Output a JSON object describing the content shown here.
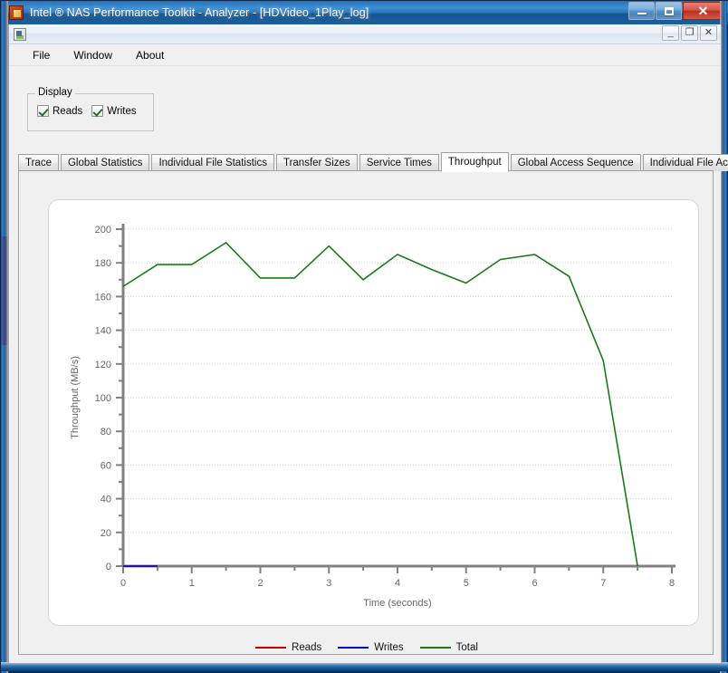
{
  "window": {
    "title": "Intel ® NAS Performance Toolkit - Analyzer - [HDVideo_1Play_log]",
    "app_icon": "app-icon",
    "buttons": {
      "minimize": "minimize-icon",
      "maximize": "maximize-icon",
      "close": "✕"
    }
  },
  "mdi": {
    "icon": "document-icon",
    "buttons": {
      "minimize": "_",
      "restore": "❐",
      "close": "✕"
    }
  },
  "menu": {
    "items": [
      {
        "label": "File"
      },
      {
        "label": "Window"
      },
      {
        "label": "About"
      }
    ]
  },
  "display_group": {
    "legend": "Display",
    "checkboxes": [
      {
        "label": "Reads",
        "checked": true
      },
      {
        "label": "Writes",
        "checked": true
      }
    ]
  },
  "tabs": {
    "active_index": 5,
    "items": [
      {
        "label": "Trace"
      },
      {
        "label": "Global Statistics"
      },
      {
        "label": "Individual File Statistics"
      },
      {
        "label": "Transfer Sizes"
      },
      {
        "label": "Service Times"
      },
      {
        "label": "Throughput"
      },
      {
        "label": "Global Access Sequence"
      },
      {
        "label": "Individual File Access Sequence"
      }
    ]
  },
  "chart_data": {
    "type": "line",
    "title": "",
    "xlabel": "Time (seconds)",
    "ylabel": "Throughput (MB/s)",
    "xlim": [
      0,
      8
    ],
    "ylim": [
      0,
      200
    ],
    "xticks": [
      0,
      1,
      2,
      3,
      4,
      5,
      6,
      7,
      8
    ],
    "xtick_labels": [
      "0",
      "1",
      "2",
      "3",
      "4",
      "5",
      "6",
      "7",
      "8"
    ],
    "x_minor_step": 0.25,
    "yticks": [
      0,
      20,
      40,
      60,
      80,
      100,
      120,
      140,
      160,
      180,
      200
    ],
    "ytick_labels": [
      "0",
      "20",
      "40",
      "60",
      "80",
      "100",
      "120",
      "140",
      "160",
      "180",
      "200"
    ],
    "y_minor_step": 10,
    "grid": true,
    "grid_axis": "y",
    "legend_position": "bottom",
    "colors": {
      "reads": "#cc0000",
      "writes": "#0000cc",
      "total": "#1a7a18",
      "grid": "#d0d0d0",
      "axis": "#808080",
      "text": "#666666"
    },
    "series": [
      {
        "name": "Reads",
        "color": "#cc0000",
        "x": [
          0,
          0.5
        ],
        "values": [
          0,
          0
        ]
      },
      {
        "name": "Writes",
        "color": "#0000cc",
        "x": [
          0,
          0.5
        ],
        "values": [
          0,
          0
        ]
      },
      {
        "name": "Total",
        "color": "#1a7a18",
        "x": [
          0,
          0.5,
          1,
          1.5,
          2,
          2.5,
          3,
          3.5,
          4,
          4.5,
          5,
          5.5,
          6,
          6.5,
          7,
          7.5
        ],
        "values": [
          166,
          179,
          179,
          192,
          171,
          171,
          190,
          170,
          185,
          176,
          168,
          182,
          185,
          172,
          122,
          0
        ]
      }
    ],
    "legend_entries": [
      {
        "label": "Reads",
        "color": "#cc0000"
      },
      {
        "label": "Writes",
        "color": "#0000cc"
      },
      {
        "label": "Total",
        "color": "#1a7a18"
      }
    ]
  }
}
